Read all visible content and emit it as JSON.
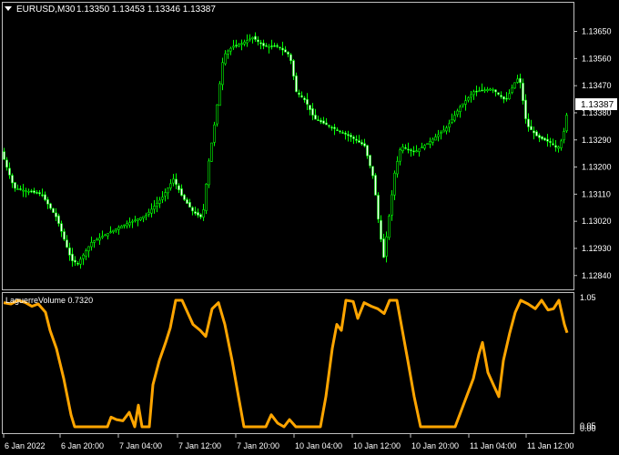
{
  "header": {
    "dropdown_icon": "triangle-down-icon",
    "symbol_label": "EURUSD,M30",
    "ohlc_label": "1.13350 1.13453 1.13346 1.13387"
  },
  "current_price_label": "1.13387",
  "indicator": {
    "label": "LaguerreVolume 0.7320"
  },
  "colors": {
    "background": "#000000",
    "frame": "#c0c0c0",
    "bull_candle": "#00ff00",
    "indicator_line": "#ffa500",
    "price_tag_bg": "#ffffff",
    "price_tag_text": "#000000"
  },
  "chart_data": [
    {
      "type": "candlestick",
      "title": "EURUSD,M30",
      "ylim": [
        1.128,
        1.137
      ],
      "y_ticks": [
        "1.13650",
        "1.13560",
        "1.13470",
        "1.13380",
        "1.13290",
        "1.13200",
        "1.13110",
        "1.13020",
        "1.12930",
        "1.12840"
      ],
      "x_ticks": [
        "6 Jan 2022",
        "6 Jan 20:00",
        "7 Jan 04:00",
        "7 Jan 12:00",
        "7 Jan 20:00",
        "10 Jan 04:00",
        "10 Jan 12:00",
        "10 Jan 20:00",
        "11 Jan 04:00",
        "11 Jan 12:00"
      ],
      "close_profile": [
        [
          0,
          1.1326
        ],
        [
          15,
          1.1313
        ],
        [
          45,
          1.1311
        ],
        [
          62,
          1.1303
        ],
        [
          78,
          1.1289
        ],
        [
          85,
          1.1288
        ],
        [
          100,
          1.1295
        ],
        [
          130,
          1.13
        ],
        [
          160,
          1.1304
        ],
        [
          178,
          1.131
        ],
        [
          190,
          1.1316
        ],
        [
          200,
          1.131
        ],
        [
          212,
          1.1305
        ],
        [
          222,
          1.1303
        ],
        [
          228,
          1.132
        ],
        [
          236,
          1.1336
        ],
        [
          245,
          1.1357
        ],
        [
          255,
          1.136
        ],
        [
          265,
          1.1361
        ],
        [
          277,
          1.1363
        ],
        [
          290,
          1.136
        ],
        [
          305,
          1.136
        ],
        [
          318,
          1.1357
        ],
        [
          325,
          1.1345
        ],
        [
          335,
          1.1342
        ],
        [
          345,
          1.1336
        ],
        [
          365,
          1.1333
        ],
        [
          385,
          1.133
        ],
        [
          400,
          1.1327
        ],
        [
          410,
          1.1316
        ],
        [
          416,
          1.13
        ],
        [
          421,
          1.129
        ],
        [
          428,
          1.1306
        ],
        [
          433,
          1.1318
        ],
        [
          440,
          1.1327
        ],
        [
          455,
          1.1325
        ],
        [
          470,
          1.1328
        ],
        [
          490,
          1.1333
        ],
        [
          505,
          1.134
        ],
        [
          520,
          1.1345
        ],
        [
          540,
          1.1346
        ],
        [
          555,
          1.1342
        ],
        [
          565,
          1.1348
        ],
        [
          570,
          1.135
        ],
        [
          578,
          1.1334
        ],
        [
          590,
          1.133
        ],
        [
          605,
          1.1328
        ],
        [
          612,
          1.1326
        ],
        [
          618,
          1.133
        ],
        [
          623,
          1.1339
        ]
      ]
    },
    {
      "type": "line",
      "title": "LaguerreVolume 0.7320",
      "ylim": [
        0,
        1.05
      ],
      "y_ticks": [
        "1.05",
        "0.05",
        "0.00"
      ],
      "series": [
        {
          "name": "LaguerreVolume",
          "points": [
            [
              4,
              1.03
            ],
            [
              12,
              1.02
            ],
            [
              20,
              1.05
            ],
            [
              28,
              1.03
            ],
            [
              35,
              1.0
            ],
            [
              42,
              1.02
            ],
            [
              50,
              0.95
            ],
            [
              55,
              0.8
            ],
            [
              62,
              0.65
            ],
            [
              70,
              0.4
            ],
            [
              78,
              0.1
            ],
            [
              82,
              0.0
            ],
            [
              118,
              0.0
            ],
            [
              122,
              0.08
            ],
            [
              128,
              0.06
            ],
            [
              135,
              0.05
            ],
            [
              142,
              0.12
            ],
            [
              148,
              0.0
            ],
            [
              152,
              0.18
            ],
            [
              156,
              0.0
            ],
            [
              164,
              0.0
            ],
            [
              168,
              0.35
            ],
            [
              175,
              0.55
            ],
            [
              182,
              0.7
            ],
            [
              187,
              0.82
            ],
            [
              193,
              1.05
            ],
            [
              200,
              1.05
            ],
            [
              206,
              0.95
            ],
            [
              212,
              0.85
            ],
            [
              220,
              0.8
            ],
            [
              226,
              0.75
            ],
            [
              233,
              0.98
            ],
            [
              240,
              1.03
            ],
            [
              247,
              0.85
            ],
            [
              255,
              0.55
            ],
            [
              262,
              0.25
            ],
            [
              268,
              0.0
            ],
            [
              292,
              0.0
            ],
            [
              298,
              0.1
            ],
            [
              305,
              0.03
            ],
            [
              312,
              0.0
            ],
            [
              318,
              0.06
            ],
            [
              325,
              0.0
            ],
            [
              352,
              0.0
            ],
            [
              358,
              0.25
            ],
            [
              365,
              0.65
            ],
            [
              370,
              0.85
            ],
            [
              375,
              0.8
            ],
            [
              380,
              1.05
            ],
            [
              388,
              1.04
            ],
            [
              393,
              0.9
            ],
            [
              400,
              1.03
            ],
            [
              408,
              1.0
            ],
            [
              415,
              0.98
            ],
            [
              422,
              0.94
            ],
            [
              428,
              1.05
            ],
            [
              436,
              1.05
            ],
            [
              442,
              0.8
            ],
            [
              448,
              0.55
            ],
            [
              455,
              0.25
            ],
            [
              462,
              0.0
            ],
            [
              500,
              0.0
            ],
            [
              505,
              0.1
            ],
            [
              510,
              0.2
            ],
            [
              515,
              0.3
            ],
            [
              520,
              0.4
            ],
            [
              526,
              0.6
            ],
            [
              530,
              0.7
            ],
            [
              536,
              0.45
            ],
            [
              542,
              0.35
            ],
            [
              548,
              0.25
            ],
            [
              553,
              0.55
            ],
            [
              560,
              0.78
            ],
            [
              566,
              0.95
            ],
            [
              572,
              1.05
            ],
            [
              580,
              1.02
            ],
            [
              588,
              0.98
            ],
            [
              595,
              1.05
            ],
            [
              602,
              0.97
            ],
            [
              608,
              0.98
            ],
            [
              614,
              1.05
            ],
            [
              620,
              0.85
            ],
            [
              623,
              0.78
            ]
          ]
        }
      ]
    }
  ]
}
